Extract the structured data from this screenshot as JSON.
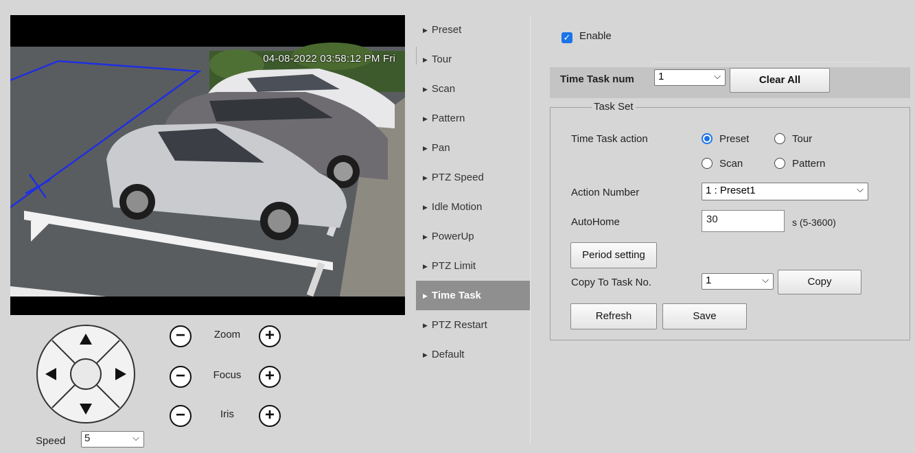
{
  "video": {
    "osd_timestamp": "04-08-2022 03:58:12 PM Fri"
  },
  "ptz": {
    "zoom_label": "Zoom",
    "focus_label": "Focus",
    "iris_label": "Iris",
    "minus_glyph": "−",
    "plus_glyph": "+",
    "speed_label": "Speed",
    "speed_value": "5"
  },
  "menu": {
    "items": [
      {
        "label": "Preset"
      },
      {
        "label": "Tour"
      },
      {
        "label": "Scan"
      },
      {
        "label": "Pattern"
      },
      {
        "label": "Pan"
      },
      {
        "label": "PTZ Speed"
      },
      {
        "label": "Idle Motion"
      },
      {
        "label": "PowerUp"
      },
      {
        "label": "PTZ Limit"
      },
      {
        "label": "Time Task"
      },
      {
        "label": "PTZ Restart"
      },
      {
        "label": "Default"
      }
    ],
    "active": "Time Task"
  },
  "panel": {
    "enable_label": "Enable",
    "enable_checked": true,
    "task_num_label": "Time Task num",
    "task_num_value": "1",
    "clear_all_label": "Clear All",
    "task_set_legend": "Task Set",
    "time_task_action_label": "Time Task action",
    "actions": [
      {
        "label": "Preset",
        "selected": true
      },
      {
        "label": "Tour",
        "selected": false
      },
      {
        "label": "Scan",
        "selected": false
      },
      {
        "label": "Pattern",
        "selected": false
      }
    ],
    "action_number_label": "Action Number",
    "action_number_value": "1 : Preset1",
    "autohome_label": "AutoHome",
    "autohome_value": "30",
    "autohome_unit": "s (5-3600)",
    "period_setting_label": "Period setting",
    "copy_to_label": "Copy To Task No.",
    "copy_to_value": "1",
    "copy_label": "Copy",
    "refresh_label": "Refresh",
    "save_label": "Save"
  },
  "colors": {
    "accent": "#1a73e8",
    "menu_active_bg": "#8f8f8f",
    "page_bg": "#d6d6d6"
  }
}
